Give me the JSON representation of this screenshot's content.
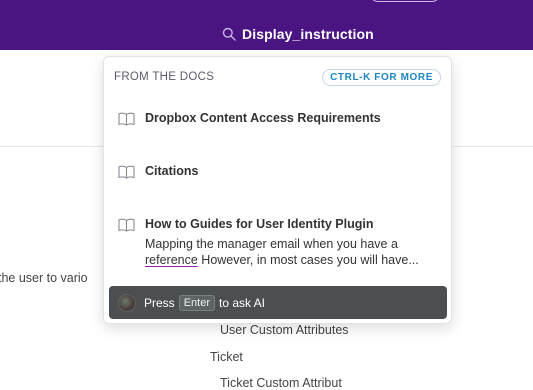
{
  "search": {
    "query": "Display_instruction"
  },
  "background": {
    "partial_text": "the user to vario",
    "items": [
      "User Custom Attributes",
      "Ticket",
      "Ticket Custom Attribut"
    ]
  },
  "dropdown": {
    "section_title": "FROM THE DOCS",
    "shortcut_hint": "CTRL-K FOR MORE",
    "results": [
      {
        "title": "Dropbox Content Access Requirements",
        "icon": "book-icon"
      },
      {
        "title": "Citations",
        "icon": "book-icon"
      },
      {
        "title": "How to Guides for User Identity Plugin",
        "icon": "book-icon",
        "snippet_line1": "Mapping the manager email when you have a",
        "snippet_highlight": "reference",
        "snippet_line2_rest": " However, in most cases you will have..."
      }
    ],
    "ask_ai": {
      "press": "Press",
      "key": "Enter",
      "suffix": "to ask AI"
    }
  },
  "colors": {
    "topbar": "#4a1482",
    "ask_ai_bg": "#4b4f52",
    "badge_text": "#1c86c4"
  }
}
